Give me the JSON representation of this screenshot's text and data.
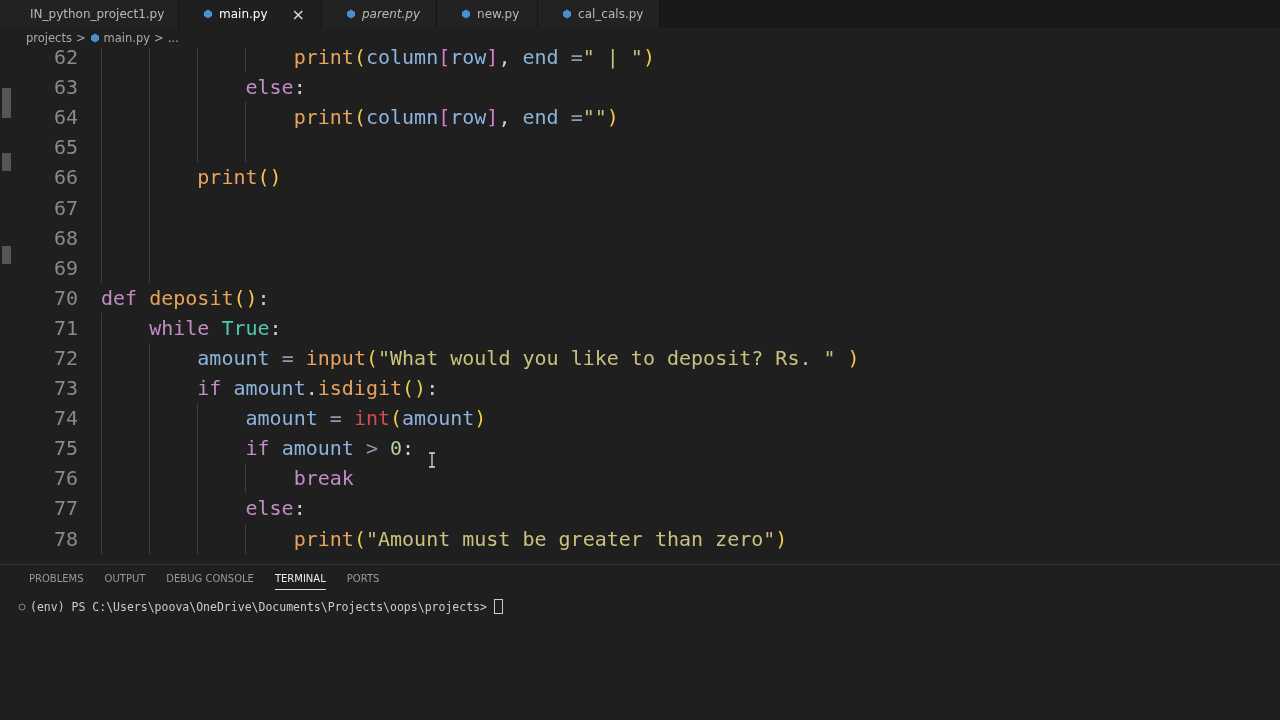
{
  "tabs": [
    {
      "label": "IN_python_project1.py",
      "selected": false,
      "preview": false,
      "closable": false
    },
    {
      "label": "main.py",
      "selected": true,
      "preview": false,
      "closable": true,
      "close": "×"
    },
    {
      "label": "parent.py",
      "selected": false,
      "preview": true,
      "closable": false
    },
    {
      "label": "new.py",
      "selected": false,
      "preview": false,
      "closable": false
    },
    {
      "label": "cal_cals.py",
      "selected": false,
      "preview": false,
      "closable": false
    }
  ],
  "breadcrumb": {
    "folder": "projects",
    "sep1": ">",
    "file": "main.py",
    "sep2": ">",
    "more": "..."
  },
  "code": [
    {
      "number": "62",
      "tokens": [
        {
          "kind": "fn",
          "text": "                print"
        },
        {
          "kind": "paren",
          "text": "("
        },
        {
          "kind": "var",
          "text": "column"
        },
        {
          "kind": "bracket",
          "text": "["
        },
        {
          "kind": "var",
          "text": "row"
        },
        {
          "kind": "bracket",
          "text": "]"
        },
        {
          "kind": "punct",
          "text": ", "
        },
        {
          "kind": "var",
          "text": "end "
        },
        {
          "kind": "op",
          "text": "="
        },
        {
          "kind": "str",
          "text": "\" | \""
        },
        {
          "kind": "paren",
          "text": ")"
        }
      ]
    },
    {
      "number": "63",
      "tokens": [
        {
          "kind": "kw",
          "text": "            else"
        },
        {
          "kind": "punct",
          "text": ":"
        }
      ]
    },
    {
      "number": "64",
      "tokens": [
        {
          "kind": "fn",
          "text": "                print"
        },
        {
          "kind": "paren",
          "text": "("
        },
        {
          "kind": "var",
          "text": "column"
        },
        {
          "kind": "bracket",
          "text": "["
        },
        {
          "kind": "var",
          "text": "row"
        },
        {
          "kind": "bracket",
          "text": "]"
        },
        {
          "kind": "punct",
          "text": ", "
        },
        {
          "kind": "var",
          "text": "end "
        },
        {
          "kind": "op",
          "text": "="
        },
        {
          "kind": "str",
          "text": "\"\""
        },
        {
          "kind": "paren",
          "text": ")"
        }
      ]
    },
    {
      "number": "65"
    },
    {
      "number": "66",
      "tokens": [
        {
          "kind": "fn",
          "text": "        print"
        },
        {
          "kind": "paren",
          "text": "()"
        }
      ]
    },
    {
      "number": "67"
    },
    {
      "number": "68"
    },
    {
      "number": "69"
    },
    {
      "number": "70",
      "tokens": [
        {
          "kind": "kw",
          "text": "def "
        },
        {
          "kind": "fn",
          "text": "deposit"
        },
        {
          "kind": "paren",
          "text": "()"
        },
        {
          "kind": "punct",
          "text": ":"
        }
      ]
    },
    {
      "number": "71",
      "tokens": [
        {
          "kind": "kw",
          "text": "    while "
        },
        {
          "kind": "const",
          "text": "True"
        },
        {
          "kind": "punct",
          "text": ":"
        }
      ]
    },
    {
      "number": "72",
      "tokens": [
        {
          "kind": "var",
          "text": "        amount "
        },
        {
          "kind": "op",
          "text": "= "
        },
        {
          "kind": "fn",
          "text": "input"
        },
        {
          "kind": "paren",
          "text": "("
        },
        {
          "kind": "str",
          "text": "\"What would you like to deposit? Rs. \" "
        },
        {
          "kind": "paren",
          "text": ")"
        }
      ]
    },
    {
      "number": "73",
      "tokens": [
        {
          "kind": "kw",
          "text": "        if "
        },
        {
          "kind": "var",
          "text": "amount"
        },
        {
          "kind": "punct",
          "text": "."
        },
        {
          "kind": "fn",
          "text": "isdigit"
        },
        {
          "kind": "paren",
          "text": "()"
        },
        {
          "kind": "punct",
          "text": ":"
        }
      ]
    },
    {
      "number": "74",
      "tokens": [
        {
          "kind": "var",
          "text": "            amount "
        },
        {
          "kind": "op",
          "text": "= "
        },
        {
          "kind": "builtin",
          "text": "int"
        },
        {
          "kind": "paren",
          "text": "("
        },
        {
          "kind": "var",
          "text": "amount"
        },
        {
          "kind": "paren",
          "text": ")"
        }
      ]
    },
    {
      "number": "75",
      "tokens": [
        {
          "kind": "kw",
          "text": "            if "
        },
        {
          "kind": "var",
          "text": "amount "
        },
        {
          "kind": "op",
          "text": "> "
        },
        {
          "kind": "num",
          "text": "0"
        },
        {
          "kind": "punct",
          "text": ":"
        }
      ]
    },
    {
      "number": "76",
      "tokens": [
        {
          "kind": "kw",
          "text": "                break"
        }
      ]
    },
    {
      "number": "77",
      "tokens": [
        {
          "kind": "kw",
          "text": "            else"
        },
        {
          "kind": "punct",
          "text": ":"
        }
      ]
    },
    {
      "number": "78",
      "tokens": [
        {
          "kind": "fn",
          "text": "                print"
        },
        {
          "kind": "paren",
          "text": "("
        },
        {
          "kind": "str",
          "text": "\"Amount must be greater than zero\""
        },
        {
          "kind": "paren",
          "text": ")"
        }
      ]
    }
  ],
  "panel": {
    "tabs": [
      {
        "label": "PROBLEMS",
        "selected": false
      },
      {
        "label": "OUTPUT",
        "selected": false
      },
      {
        "label": "DEBUG CONSOLE",
        "selected": false
      },
      {
        "label": "TERMINAL",
        "selected": true
      },
      {
        "label": "PORTS",
        "selected": false
      }
    ],
    "prompt": "(env) PS C:\\Users\\poova\\OneDrive\\Documents\\Projects\\oops\\projects>"
  }
}
